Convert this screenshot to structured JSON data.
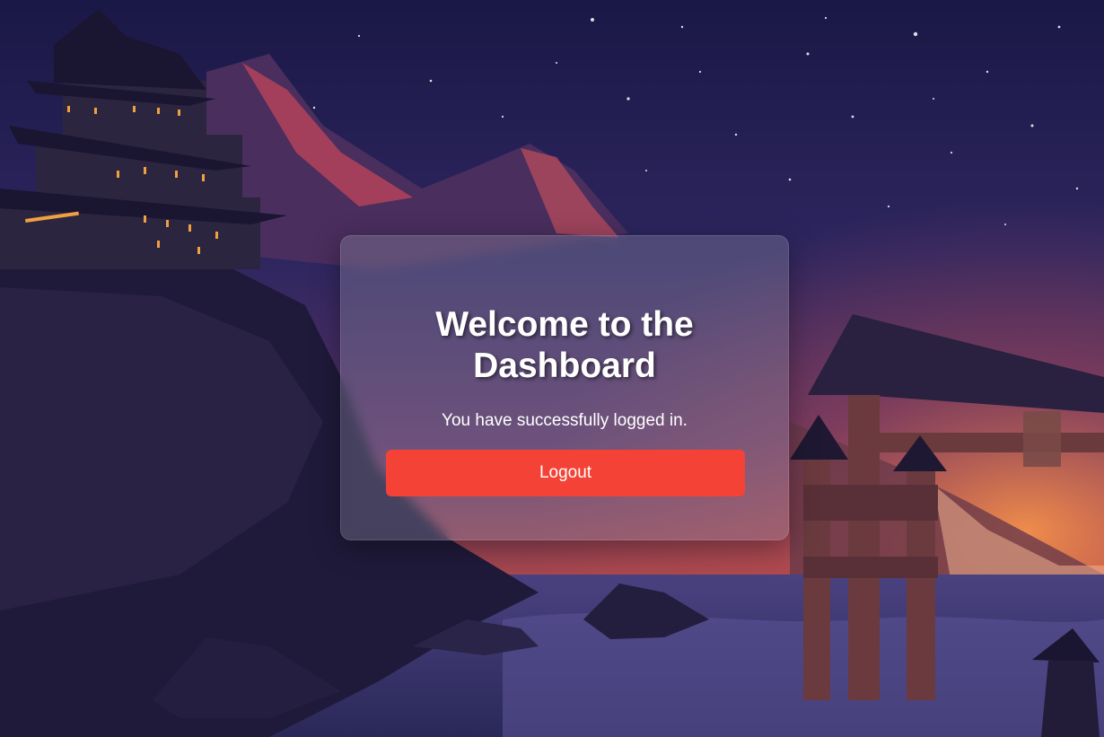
{
  "colors": {
    "sky_top": "#1c1a4a",
    "sky_mid": "#3b2a63",
    "horizon_glow": "#f07a3c",
    "water": "#3a3a70",
    "silhouette": "#1d1836",
    "gate": "#6b3a3c",
    "card_overlay": "rgba(150,150,170,0.32)",
    "logout_button": "#f44336"
  },
  "card": {
    "title": "Welcome to the Dashboard",
    "message": "You have successfully logged in.",
    "logout_label": "Logout"
  }
}
